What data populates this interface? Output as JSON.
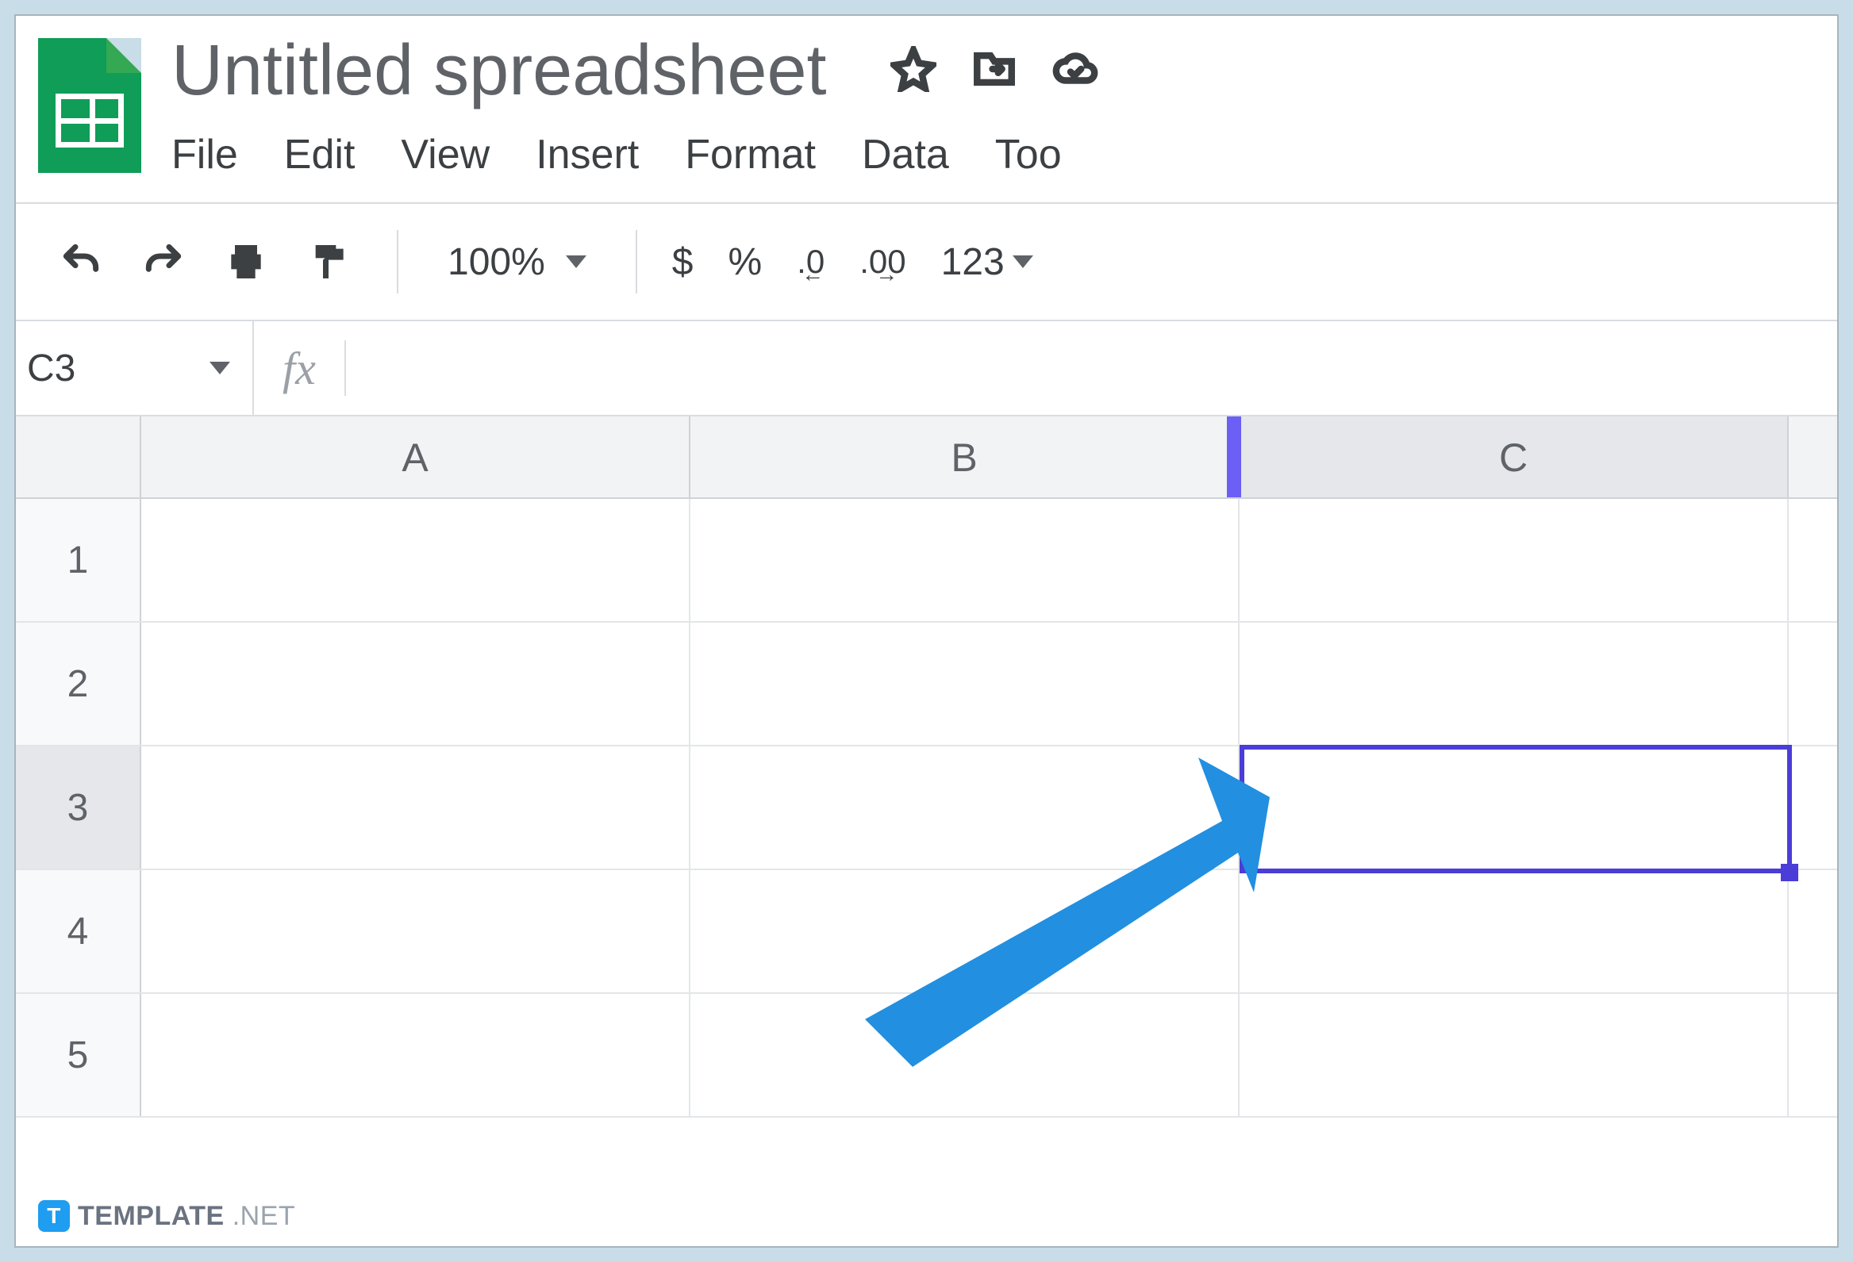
{
  "header": {
    "title": "Untitled spreadsheet"
  },
  "menubar": {
    "items": [
      "File",
      "Edit",
      "View",
      "Insert",
      "Format",
      "Data",
      "Too"
    ]
  },
  "toolbar": {
    "zoom": "100%",
    "currency": "$",
    "percent": "%",
    "dec_less": ".0",
    "dec_more": ".00",
    "numfmt": "123"
  },
  "namebox": "C3",
  "fx_symbol": "fx",
  "formula_value": "",
  "grid": {
    "columns": [
      "A",
      "B",
      "C"
    ],
    "rows": [
      "1",
      "2",
      "3",
      "4",
      "5"
    ],
    "active_column": "C",
    "active_row": "3",
    "selected_cell": "C3"
  },
  "watermark": {
    "badge": "T",
    "brand": "TEMPLATE",
    "suffix": ".NET"
  }
}
